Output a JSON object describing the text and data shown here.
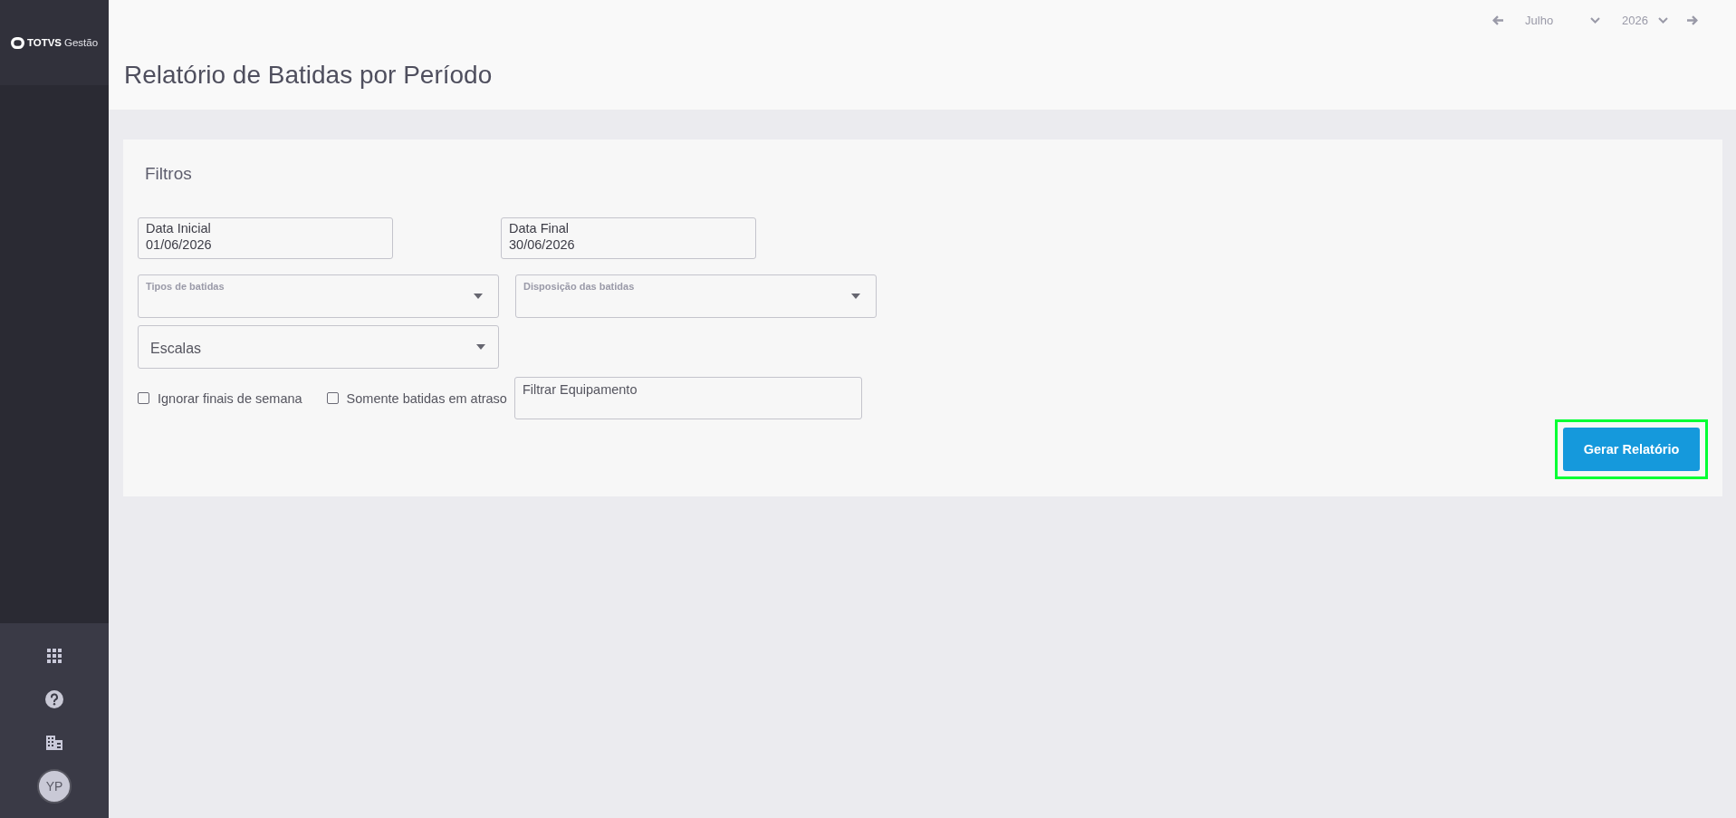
{
  "sidebar": {
    "logo": {
      "brand": "TOTVS",
      "product": "Gestão"
    },
    "user": {
      "initials": "YP"
    }
  },
  "period_selector": {
    "month": "Julho",
    "year": "2026"
  },
  "page_title": "Relatório de Batidas por Período",
  "filters": {
    "title": "Filtros",
    "date_fields": [
      {
        "label": "Data Inicial",
        "value": "01/06/2026"
      },
      {
        "label": "Data Final",
        "value": "30/06/2026"
      }
    ],
    "selects": [
      {
        "kind": "labeled",
        "label": "Tipos de batidas"
      },
      {
        "kind": "labeled",
        "label": "Disposição das batidas"
      },
      {
        "kind": "placeholder",
        "placeholder": "Escalas"
      }
    ],
    "checkboxes": [
      {
        "label": "Ignorar finais de semana",
        "checked": false
      },
      {
        "label": "Somente batidas em atraso",
        "checked": false
      }
    ],
    "equipment_field": {
      "placeholder": "Filtrar Equipamento"
    },
    "submit_button": {
      "label": "Gerar Relatório",
      "focused": true
    }
  }
}
